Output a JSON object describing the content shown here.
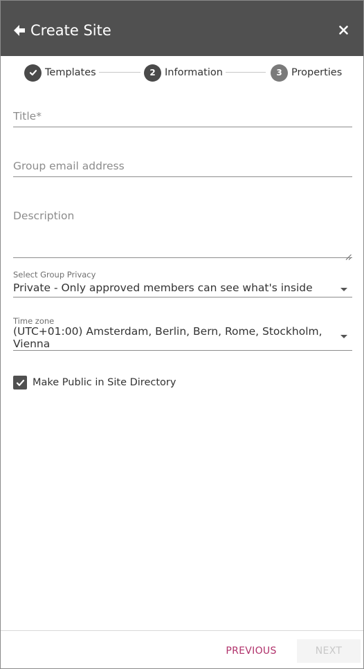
{
  "header": {
    "title": "Create Site",
    "back_icon": "arrow-left-icon",
    "close_icon": "close-icon",
    "background_color": "#505050"
  },
  "stepper": {
    "steps": [
      {
        "label": "Templates",
        "marker": "",
        "state": "completed"
      },
      {
        "label": "Information",
        "marker": "2",
        "state": "current"
      },
      {
        "label": "Properties",
        "marker": "3",
        "state": "upcoming"
      }
    ]
  },
  "form": {
    "title_placeholder": "Title*",
    "title_value": "",
    "email_placeholder": "Group email address",
    "email_value": "",
    "description_placeholder": "Description",
    "description_value": "",
    "privacy": {
      "label": "Select Group Privacy",
      "value": "Private - Only approved members can see what's inside"
    },
    "timezone": {
      "label": "Time zone",
      "value": "(UTC+01:00) Amsterdam, Berlin, Bern, Rome, Stockholm, Vienna"
    },
    "public_directory": {
      "label": "Make Public in Site Directory",
      "checked": true
    }
  },
  "footer": {
    "previous_label": "PREVIOUS",
    "next_label": "NEXT",
    "previous_color": "#b0306a",
    "next_enabled": false
  }
}
